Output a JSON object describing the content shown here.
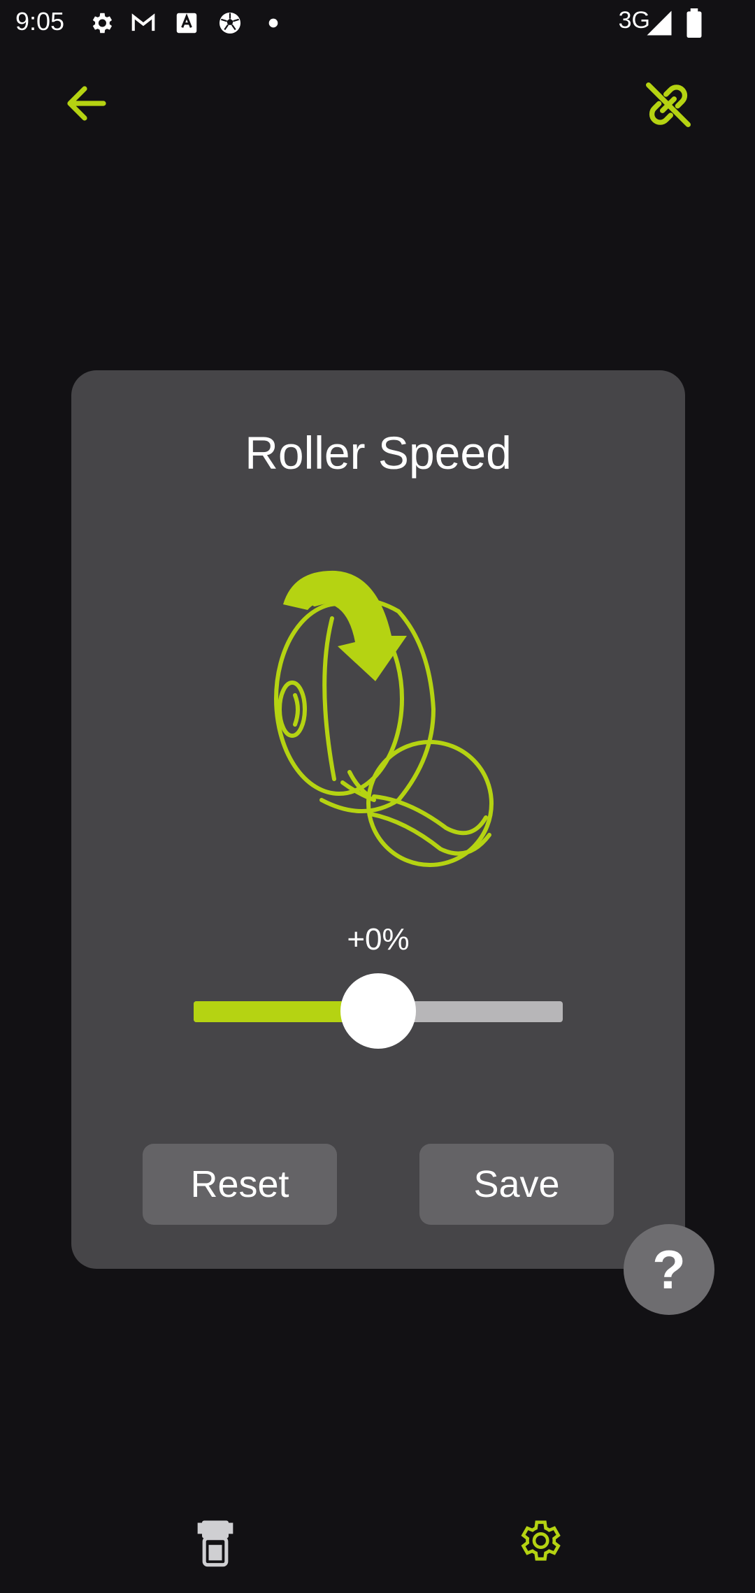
{
  "status_bar": {
    "time": "9:05",
    "network": "3G",
    "icons": [
      "settings-icon",
      "gmail-icon",
      "text-badge-icon",
      "soccer-ball-icon",
      "dot-icon",
      "signal-icon",
      "battery-icon"
    ]
  },
  "top_bar": {
    "back_icon": "arrow-left-icon",
    "link_icon": "link-off-icon"
  },
  "card": {
    "title": "Roller Speed",
    "illustration": "roller-ball-icon",
    "slider": {
      "value_label": "+0%",
      "fraction": 0.5
    },
    "reset_label": "Reset",
    "save_label": "Save"
  },
  "help": {
    "label": "?"
  },
  "bottom_nav": {
    "items": [
      "machine-icon",
      "settings-icon"
    ]
  },
  "colors": {
    "accent": "#b5d312",
    "background": "#121114",
    "card": "#464548",
    "button": "#646366"
  }
}
